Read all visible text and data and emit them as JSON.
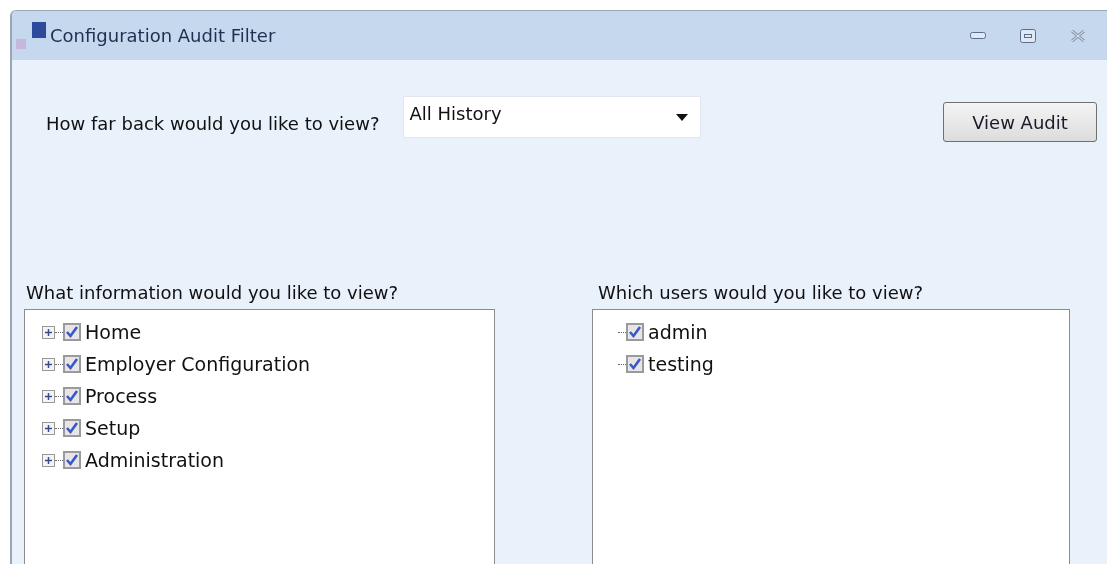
{
  "window": {
    "title": "Configuration Audit Filter"
  },
  "history": {
    "label": "How far back would you like to view?",
    "value": "All History"
  },
  "view_button": "View Audit",
  "information": {
    "label": "What information would you like to view?",
    "items": [
      {
        "label": "Home",
        "checked": true,
        "expanded": false
      },
      {
        "label": "Employer Configuration",
        "checked": true,
        "expanded": false
      },
      {
        "label": "Process",
        "checked": true,
        "expanded": false
      },
      {
        "label": "Setup",
        "checked": true,
        "expanded": false
      },
      {
        "label": "Administration",
        "checked": true,
        "expanded": false
      }
    ]
  },
  "users": {
    "label": "Which users would you like to view?",
    "items": [
      {
        "label": "admin",
        "checked": true
      },
      {
        "label": "testing",
        "checked": true
      }
    ]
  }
}
